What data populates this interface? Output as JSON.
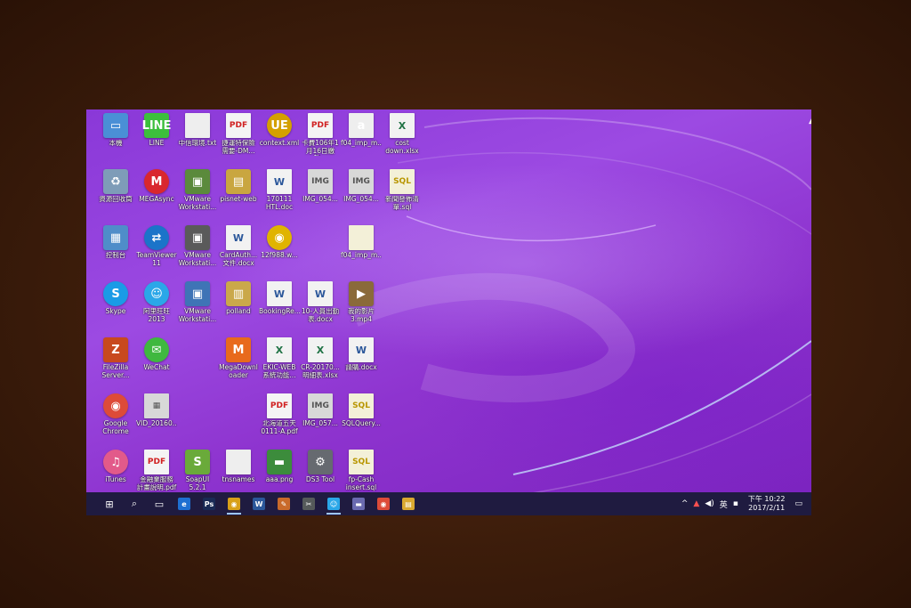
{
  "desktop": {
    "icons": [
      {
        "name": "this-pc",
        "label": "本機",
        "glyph": "▭",
        "style": "",
        "bg": "#4a8fd6",
        "col": 0,
        "row": 0
      },
      {
        "name": "line",
        "label": "LINE",
        "glyph": "LINE",
        "style": "",
        "bg": "#3cbf3c",
        "col": 1,
        "row": 0
      },
      {
        "name": "txt-file",
        "label": "中信環境.txt",
        "glyph": "",
        "style": "txt",
        "bg": "",
        "col": 2,
        "row": 0
      },
      {
        "name": "pdf-dm",
        "label": "捷運特保險\n需要-DM...",
        "glyph": "PDF",
        "style": "pdf",
        "bg": "",
        "col": 3,
        "row": 0
      },
      {
        "name": "context-xml",
        "label": "context.xml",
        "glyph": "UE",
        "style": "round",
        "bg": "#d4a000",
        "col": 4,
        "row": 0
      },
      {
        "name": "pdf-106",
        "label": "卡費106年1\n月16日繳款...",
        "glyph": "PDF",
        "style": "pdf",
        "bg": "",
        "col": 5,
        "row": 0
      },
      {
        "name": "f04-imp-1",
        "label": "f04_imp_m...",
        "glyph": "a",
        "style": "txt",
        "bg": "",
        "col": 6,
        "row": 0
      },
      {
        "name": "cost-xlsx",
        "label": "cost\ndown.xlsx",
        "glyph": "X",
        "style": "xls",
        "bg": "",
        "col": 7,
        "row": 0
      },
      {
        "name": "recycle-bin",
        "label": "資源回收筒",
        "glyph": "♻",
        "style": "",
        "bg": "#7e9cb8",
        "col": 0,
        "row": 1
      },
      {
        "name": "megasync",
        "label": "MEGAsync",
        "glyph": "M",
        "style": "round",
        "bg": "#d9272e",
        "col": 1,
        "row": 1
      },
      {
        "name": "vmware-1",
        "label": "VMware\nWorkstati...",
        "glyph": "▣",
        "style": "",
        "bg": "#5b8a3c",
        "col": 2,
        "row": 1
      },
      {
        "name": "pisnet-web",
        "label": "pisnet-web",
        "glyph": "▤",
        "style": "",
        "bg": "#c9a640",
        "col": 3,
        "row": 1
      },
      {
        "name": "doc-170111",
        "label": "170111\nHTL.doc",
        "glyph": "W",
        "style": "doc",
        "bg": "",
        "col": 4,
        "row": 1
      },
      {
        "name": "img-054-a",
        "label": "IMG_054...",
        "glyph": "IMG",
        "style": "img",
        "bg": "",
        "col": 5,
        "row": 1
      },
      {
        "name": "img-054-b",
        "label": "IMG_054...",
        "glyph": "IMG",
        "style": "img",
        "bg": "",
        "col": 6,
        "row": 1
      },
      {
        "name": "sql-1",
        "label": "新聞發佈清\n單.sql",
        "glyph": "SQL",
        "style": "sql",
        "bg": "",
        "col": 7,
        "row": 1
      },
      {
        "name": "control-panel",
        "label": "控制台",
        "glyph": "▦",
        "style": "",
        "bg": "#4f8dc9",
        "col": 0,
        "row": 2
      },
      {
        "name": "teamviewer",
        "label": "TeamViewer\n11",
        "glyph": "⇄",
        "style": "round",
        "bg": "#1b74c9",
        "col": 1,
        "row": 2
      },
      {
        "name": "vmware-2",
        "label": "VMware\nWorkstati...",
        "glyph": "▣",
        "style": "",
        "bg": "#5a5a5a",
        "col": 2,
        "row": 2
      },
      {
        "name": "cardauth-docx",
        "label": "CardAuth...\n文件.docx",
        "glyph": "W",
        "style": "doc",
        "bg": "",
        "col": 3,
        "row": 2
      },
      {
        "name": "chrome-12f",
        "label": "12f988.w...",
        "glyph": "◉",
        "style": "round",
        "bg": "#e0b400",
        "col": 4,
        "row": 2
      },
      {
        "name": "f04-imp-2",
        "label": "f04_imp_m...",
        "glyph": "",
        "style": "sql",
        "bg": "",
        "col": 6,
        "row": 2
      },
      {
        "name": "skype",
        "label": "Skype",
        "glyph": "S",
        "style": "round",
        "bg": "#1a9be6",
        "col": 0,
        "row": 3
      },
      {
        "name": "aliwangwang",
        "label": "阿里旺旺\n2013",
        "glyph": "☺",
        "style": "round",
        "bg": "#2aa7e8",
        "col": 1,
        "row": 3
      },
      {
        "name": "vmware-3",
        "label": "VMware\nWorkstati...",
        "glyph": "▣",
        "style": "",
        "bg": "#3f74b6",
        "col": 2,
        "row": 3
      },
      {
        "name": "polland",
        "label": "polland",
        "glyph": "▥",
        "style": "",
        "bg": "#caa84a",
        "col": 3,
        "row": 3
      },
      {
        "name": "bookingre",
        "label": "BookingRe...",
        "glyph": "W",
        "style": "doc",
        "bg": "",
        "col": 4,
        "row": 3
      },
      {
        "name": "doc-10",
        "label": "10-人員出勤\n表.docx",
        "glyph": "W",
        "style": "doc",
        "bg": "",
        "col": 5,
        "row": 3
      },
      {
        "name": "mp4-file",
        "label": "我的影片\n3.mp4",
        "glyph": "▶",
        "style": "",
        "bg": "#8a6a3a",
        "col": 6,
        "row": 3
      },
      {
        "name": "filezilla",
        "label": "FileZilla\nServer...",
        "glyph": "Z",
        "style": "",
        "bg": "#c8491e",
        "col": 0,
        "row": 4
      },
      {
        "name": "wechat",
        "label": "WeChat",
        "glyph": "✉",
        "style": "round",
        "bg": "#3fb83f",
        "col": 1,
        "row": 4
      },
      {
        "name": "megadownloader",
        "label": "MegaDownl\noader",
        "glyph": "M",
        "style": "",
        "bg": "#e86a1c",
        "col": 3,
        "row": 4
      },
      {
        "name": "ekicweb",
        "label": "EKIC-WEB\n系統功能...",
        "glyph": "X",
        "style": "xls",
        "bg": "",
        "col": 4,
        "row": 4
      },
      {
        "name": "cr-2017",
        "label": "CR-20170...\n明細表.xlsx",
        "glyph": "X",
        "style": "xls",
        "bg": "",
        "col": 5,
        "row": 4
      },
      {
        "name": "doc-misc",
        "label": "請購.docx",
        "glyph": "W",
        "style": "doc",
        "bg": "",
        "col": 6,
        "row": 4
      },
      {
        "name": "google-chrome",
        "label": "Google\nChrome",
        "glyph": "◉",
        "style": "round",
        "bg": "#dd4b39",
        "col": 0,
        "row": 5
      },
      {
        "name": "vid-2016",
        "label": "VID_20160...",
        "glyph": "▦",
        "style": "img",
        "bg": "",
        "col": 1,
        "row": 5
      },
      {
        "name": "pdf-0111",
        "label": "北海道五天\n0111-A.pdf",
        "glyph": "PDF",
        "style": "pdf",
        "bg": "",
        "col": 4,
        "row": 5
      },
      {
        "name": "img-057",
        "label": "IMG_057...",
        "glyph": "IMG",
        "style": "img",
        "bg": "",
        "col": 5,
        "row": 5
      },
      {
        "name": "sqlquery",
        "label": "SQLQuery...",
        "glyph": "SQL",
        "style": "sql",
        "bg": "",
        "col": 6,
        "row": 5
      },
      {
        "name": "itunes",
        "label": "iTunes",
        "glyph": "♫",
        "style": "round",
        "bg": "#e25a8a",
        "col": 0,
        "row": 6
      },
      {
        "name": "pdf-bank",
        "label": "金融業服務\n計畫說明.pdf",
        "glyph": "PDF",
        "style": "pdf",
        "bg": "",
        "col": 1,
        "row": 6
      },
      {
        "name": "soapui",
        "label": "SoapUI\n5.2.1",
        "glyph": "S",
        "style": "",
        "bg": "#6aaa3a",
        "col": 2,
        "row": 6
      },
      {
        "name": "tnsnames",
        "label": "tnsnames",
        "glyph": "",
        "style": "txt",
        "bg": "",
        "col": 3,
        "row": 6
      },
      {
        "name": "aaa-png",
        "label": "aaa.png",
        "glyph": "▬",
        "style": "",
        "bg": "#3c8c3c",
        "col": 4,
        "row": 6
      },
      {
        "name": "ds3-tool",
        "label": "DS3 Tool",
        "glyph": "⚙",
        "style": "",
        "bg": "#666a70",
        "col": 5,
        "row": 6
      },
      {
        "name": "fp-cash-sql",
        "label": "fp-Cash\ninsert.sql",
        "glyph": "SQL",
        "style": "sql",
        "bg": "",
        "col": 6,
        "row": 6
      }
    ]
  },
  "taskbar": {
    "items": [
      {
        "name": "start-button",
        "glyph": "⊞",
        "bg": "",
        "active": false
      },
      {
        "name": "search-icon",
        "glyph": "⌕",
        "bg": "",
        "active": false
      },
      {
        "name": "task-view-icon",
        "glyph": "▭",
        "bg": "",
        "active": false
      },
      {
        "name": "edge-icon",
        "glyph": "e",
        "bg": "#1e6fd1",
        "active": false
      },
      {
        "name": "photoshop-icon",
        "glyph": "Ps",
        "bg": "#1a2a55",
        "active": false
      },
      {
        "name": "chrome-task-icon",
        "glyph": "◉",
        "bg": "#d8a018",
        "active": true
      },
      {
        "name": "word-task-icon",
        "glyph": "W",
        "bg": "#2b579a",
        "active": false
      },
      {
        "name": "paint-task-icon",
        "glyph": "✎",
        "bg": "#c96a2a",
        "active": false
      },
      {
        "name": "tools-task-icon",
        "glyph": "✂",
        "bg": "#555a5a",
        "active": false
      },
      {
        "name": "aliwangwang-task-icon",
        "glyph": "☺",
        "bg": "#2aa7e8",
        "active": true
      },
      {
        "name": "app-task-icon",
        "glyph": "▬",
        "bg": "#6a6ab0",
        "active": false
      },
      {
        "name": "chrome-task-icon-2",
        "glyph": "◉",
        "bg": "#dd4b39",
        "active": false
      },
      {
        "name": "explorer-task-icon",
        "glyph": "▤",
        "bg": "#d9a830",
        "active": false
      }
    ],
    "tray": {
      "chevron": "^",
      "language": "英",
      "clock_time": "下午 10:22",
      "clock_date": "2017/2/11"
    }
  }
}
